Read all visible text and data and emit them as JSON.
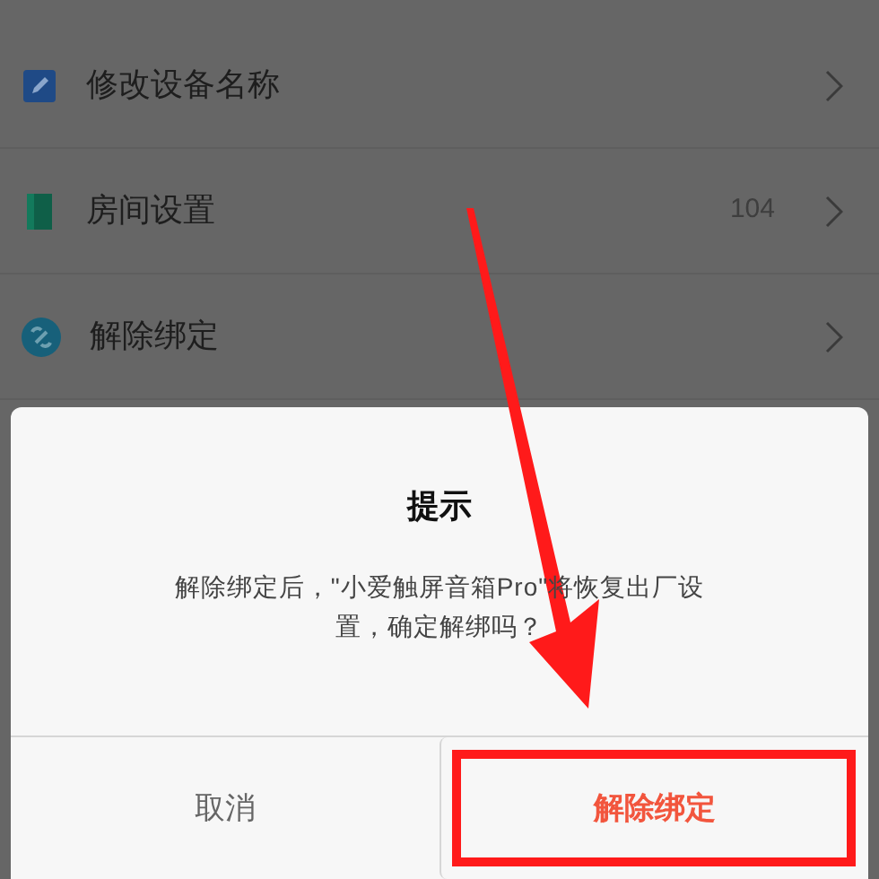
{
  "settings_list": [
    {
      "kind": "edit",
      "label": "修改设备名称"
    },
    {
      "kind": "room",
      "label": "房间设置",
      "value": "104"
    },
    {
      "kind": "unbind",
      "label": "解除绑定"
    }
  ],
  "dialog": {
    "title": "提示",
    "message": "解除绑定后，\"小爱触屏音箱Pro\"将恢复出厂设置，确定解绑吗？",
    "buttons": [
      {
        "kind": "cancel",
        "label": "取消"
      },
      {
        "kind": "confirm",
        "label": "解除绑定",
        "highlighted": true
      }
    ]
  }
}
